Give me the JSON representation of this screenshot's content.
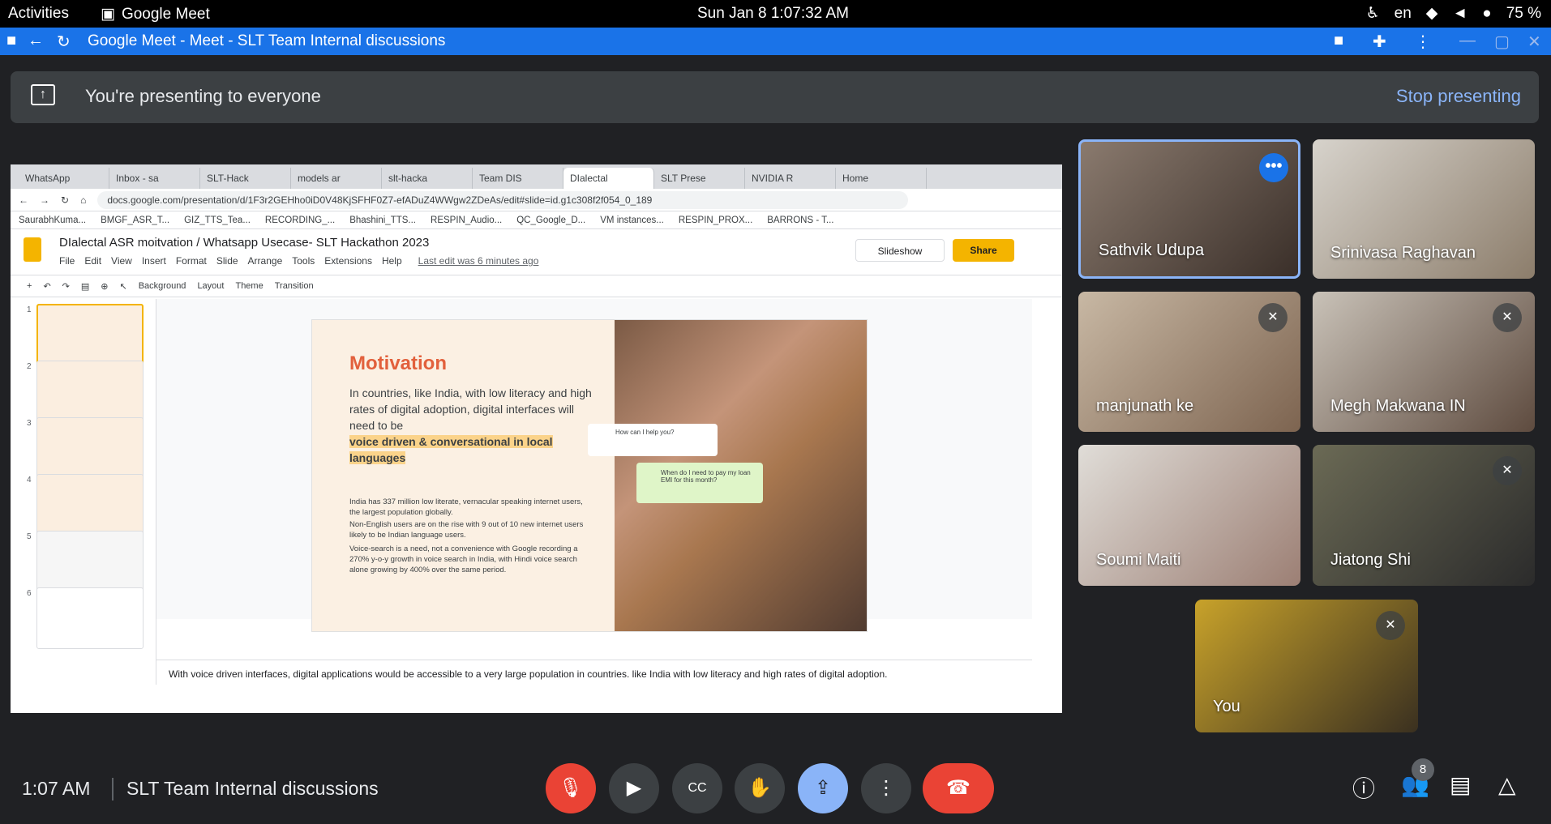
{
  "os": {
    "activities": "Activities",
    "app_name": "Google Meet",
    "clock": "Sun Jan 8   1:07:32 AM",
    "lang": "en",
    "battery": "75 %"
  },
  "browser": {
    "title": "Google Meet - Meet - SLT Team Internal discussions"
  },
  "banner": {
    "text": "You're presenting to everyone",
    "stop": "Stop presenting"
  },
  "present": {
    "tabs": [
      "WhatsApp",
      "Inbox - sa",
      "SLT-Hack",
      "models ar",
      "slt-hacka",
      "Team DIS",
      "DIalectal",
      "SLT Prese",
      "NVIDIA R",
      "Home"
    ],
    "url": "docs.google.com/presentation/d/1F3r2GEHho0iD0V48KjSFHF0Z7-efADuZ4WWgw2ZDeAs/edit#slide=id.g1c308f2f054_0_189",
    "bookmarks": [
      "SaurabhKuma...",
      "BMGF_ASR_T...",
      "GIZ_TTS_Tea...",
      "RECORDING_...",
      "Bhashini_TTS...",
      "RESPIN_Audio...",
      "QC_Google_D...",
      "VM instances...",
      "RESPIN_PROX...",
      "BARRONS - T..."
    ],
    "doc_title": "DIalectal ASR moitvation / Whatsapp Usecase- SLT Hackathon 2023",
    "menu": [
      "File",
      "Edit",
      "View",
      "Insert",
      "Format",
      "Slide",
      "Arrange",
      "Tools",
      "Extensions",
      "Help"
    ],
    "last_edit": "Last edit was 6 minutes ago",
    "slideshow": "Slideshow",
    "share": "Share",
    "toolbar": [
      "Background",
      "Layout",
      "Theme",
      "Transition"
    ],
    "thumb_nums": [
      "1",
      "2",
      "3",
      "4",
      "5",
      "6"
    ],
    "slide": {
      "heading": "Motivation",
      "para": "In countries, like India, with low literacy and high rates of digital adoption, digital interfaces will need to be",
      "highlight": "voice driven & conversational in local languages",
      "s1": "India has 337 million low literate, vernacular speaking internet users, the largest population globally.",
      "s2": "Non-English users are on the rise with 9 out of 10 new internet users likely to be Indian language users.",
      "s3": "Voice-search is a need, not a convenience with Google recording a 270% y-o-y growth in voice search in India, with Hindi voice search alone growing by 400% over the same period.",
      "bubble1": "How can I help you?",
      "bubble2": "When do I need to pay my loan EMI for this month?"
    },
    "notes": "With voice driven interfaces, digital applications would be accessible to a very large population in countries. like India with low literacy and high rates of digital adoption."
  },
  "participants": [
    {
      "name": "Sathvik Udupa"
    },
    {
      "name": "Srinivasa Raghavan"
    },
    {
      "name": "manjunath ke"
    },
    {
      "name": "Megh Makwana IN"
    },
    {
      "name": "Soumi Maiti"
    },
    {
      "name": "Jiatong Shi"
    },
    {
      "name": "You"
    }
  ],
  "bottom": {
    "time": "1:07 AM",
    "meeting": "SLT Team Internal discussions",
    "people_count": "8"
  },
  "colors": {
    "accent": "#1a73e8",
    "end_call": "#ea4335",
    "mic_off": "#ea4335",
    "present_btn": "#8ab4f8"
  }
}
